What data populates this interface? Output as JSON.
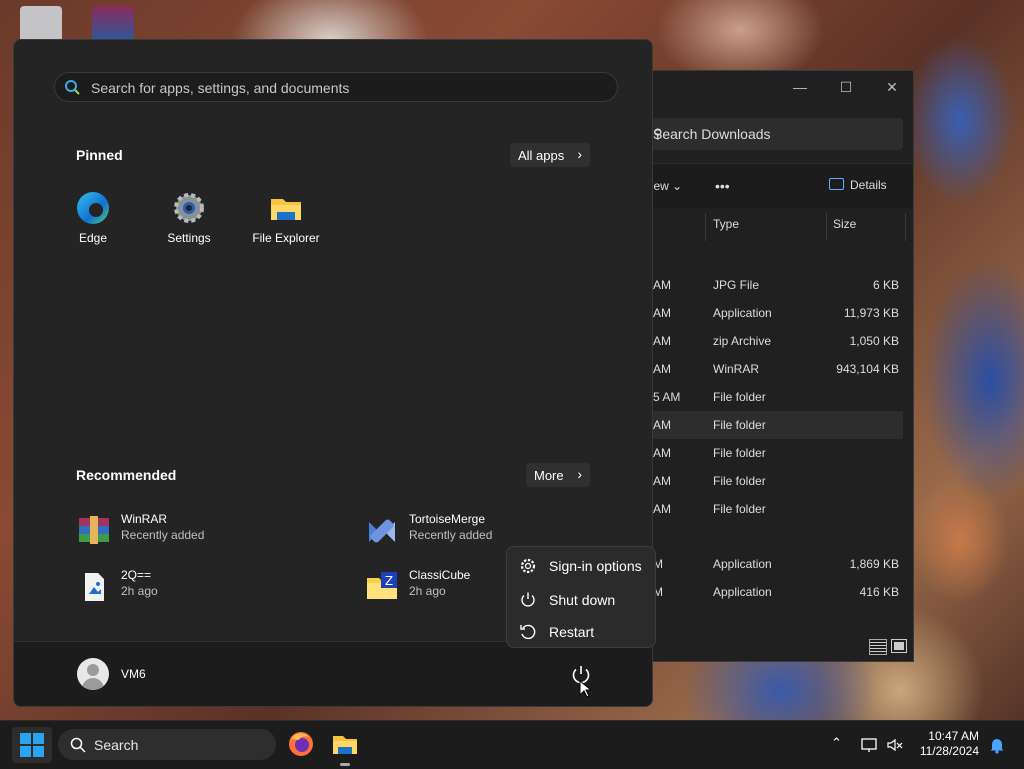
{
  "explorer": {
    "search_placeholder": "Search Downloads",
    "toolbar": {
      "view_label": "View",
      "more_label": "•••",
      "details_label": "Details"
    },
    "columns": {
      "type": "Type",
      "size": "Size"
    },
    "rows": [
      {
        "time": "AM",
        "type": "JPG File",
        "size": "6 KB"
      },
      {
        "time": "AM",
        "type": "Application",
        "size": "11,973 KB"
      },
      {
        "time": "AM",
        "type": "zip Archive",
        "size": "1,050 KB"
      },
      {
        "time": "AM",
        "type": "WinRAR",
        "size": "943,104 KB"
      },
      {
        "time": "5 AM",
        "type": "File folder",
        "size": ""
      },
      {
        "time": "AM",
        "type": "File folder",
        "size": ""
      },
      {
        "time": "AM",
        "type": "File folder",
        "size": ""
      },
      {
        "time": "AM",
        "type": "File folder",
        "size": ""
      },
      {
        "time": "AM",
        "type": "File folder",
        "size": ""
      },
      {
        "time": "M",
        "type": "Application",
        "size": "1,869 KB"
      },
      {
        "time": "M",
        "type": "Application",
        "size": "416 KB"
      }
    ]
  },
  "start_menu": {
    "search_placeholder": "Search for apps, settings, and documents",
    "pinned_title": "Pinned",
    "all_apps_label": "All apps",
    "pinned": [
      {
        "label": "Edge",
        "icon": "edge-icon"
      },
      {
        "label": "Settings",
        "icon": "settings-gear-icon"
      },
      {
        "label": "File Explorer",
        "icon": "folder-icon"
      }
    ],
    "recommended_title": "Recommended",
    "more_label": "More",
    "recommended": [
      {
        "name": "WinRAR",
        "detail": "Recently added",
        "icon": "winrar-icon"
      },
      {
        "name": "TortoiseMerge",
        "detail": "Recently added",
        "icon": "tortoisemerge-icon"
      },
      {
        "name": "2Q==",
        "detail": "2h ago",
        "icon": "image-file-icon"
      },
      {
        "name": "ClassiCube",
        "detail": "2h ago",
        "icon": "folder-zip-icon"
      }
    ],
    "user_name": "VM6"
  },
  "power_menu": {
    "items": [
      {
        "label": "Sign-in options",
        "icon": "gear-icon"
      },
      {
        "label": "Shut down",
        "icon": "power-icon"
      },
      {
        "label": "Restart",
        "icon": "restart-icon"
      }
    ]
  },
  "taskbar": {
    "search_label": "Search",
    "time": "10:47 AM",
    "date": "11/28/2024"
  },
  "colors": {
    "accent": "#0078d4",
    "menu_bg": "#242424",
    "taskbar_bg": "#1c1c1c"
  }
}
